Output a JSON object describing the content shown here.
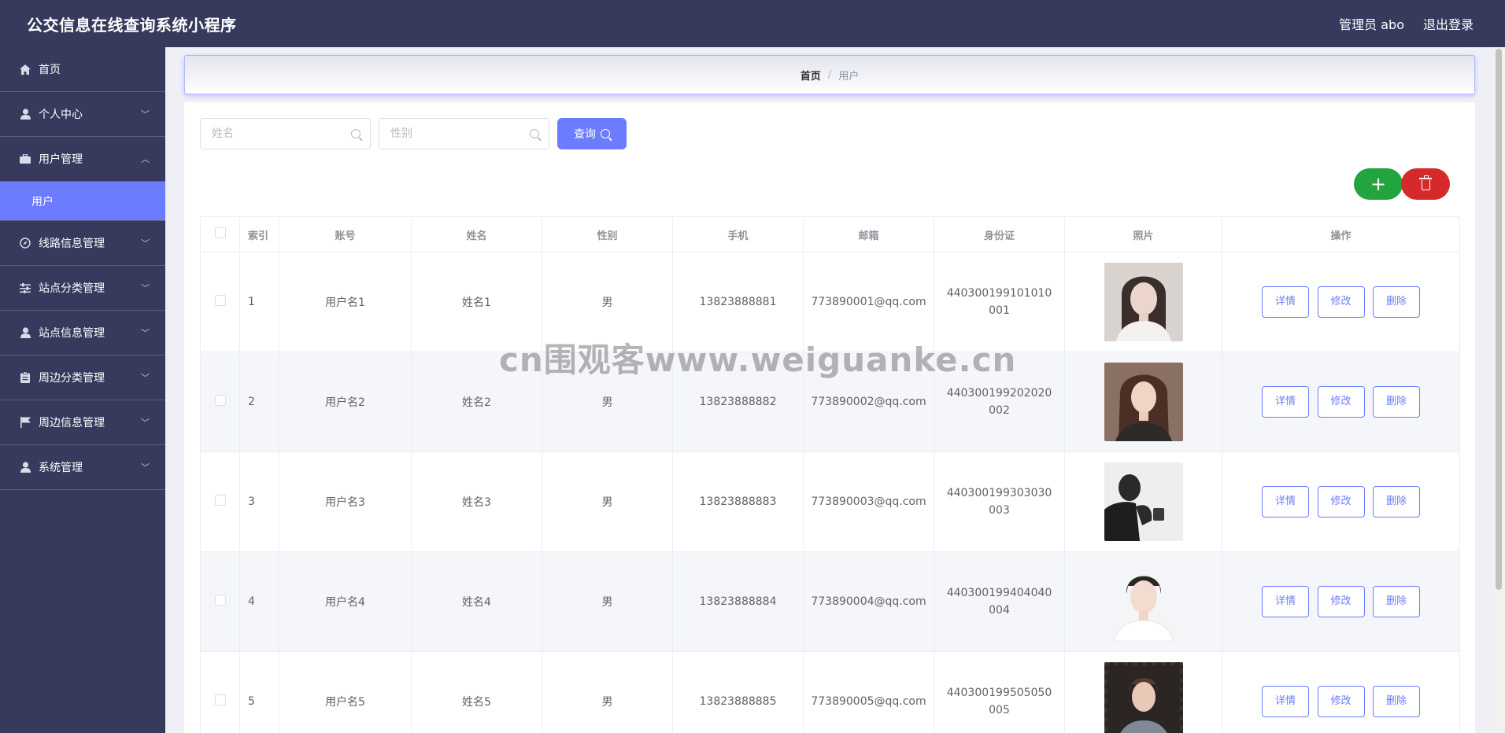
{
  "header": {
    "title": "公交信息在线查询系统小程序",
    "admin_label": "管理员 abo",
    "logout_label": "退出登录"
  },
  "sidebar": {
    "items": [
      {
        "label": "首页",
        "icon": "home-icon",
        "chevron": null
      },
      {
        "label": "个人中心",
        "icon": "user-icon",
        "chevron": "down"
      },
      {
        "label": "用户管理",
        "icon": "briefcase-icon",
        "chevron": "up"
      },
      {
        "label": "用户",
        "sub": true
      },
      {
        "label": "线路信息管理",
        "icon": "compass-icon",
        "chevron": "down"
      },
      {
        "label": "站点分类管理",
        "icon": "sliders-icon",
        "chevron": "down"
      },
      {
        "label": "站点信息管理",
        "icon": "user-icon",
        "chevron": "down"
      },
      {
        "label": "周边分类管理",
        "icon": "clipboard-icon",
        "chevron": "down"
      },
      {
        "label": "周边信息管理",
        "icon": "flag-icon",
        "chevron": "down"
      },
      {
        "label": "系统管理",
        "icon": "user-icon",
        "chevron": "down"
      }
    ]
  },
  "breadcrumb": {
    "home": "首页",
    "separator": "/",
    "current": "用户"
  },
  "search": {
    "name_placeholder": "姓名",
    "gender_placeholder": "性别",
    "query_label": "查询"
  },
  "actions": {
    "add_symbol": "+"
  },
  "table": {
    "headers": [
      "索引",
      "账号",
      "姓名",
      "性别",
      "手机",
      "邮箱",
      "身份证",
      "照片",
      "操作"
    ],
    "row_buttons": {
      "detail": "详情",
      "edit": "修改",
      "delete": "删除"
    },
    "rows": [
      {
        "index": "1",
        "account": "用户名1",
        "name": "姓名1",
        "gender": "男",
        "phone": "13823888881",
        "email": "773890001@qq.com",
        "idcard": "440300199101010001"
      },
      {
        "index": "2",
        "account": "用户名2",
        "name": "姓名2",
        "gender": "男",
        "phone": "13823888882",
        "email": "773890002@qq.com",
        "idcard": "440300199202020002"
      },
      {
        "index": "3",
        "account": "用户名3",
        "name": "姓名3",
        "gender": "男",
        "phone": "13823888883",
        "email": "773890003@qq.com",
        "idcard": "440300199303030003"
      },
      {
        "index": "4",
        "account": "用户名4",
        "name": "姓名4",
        "gender": "男",
        "phone": "13823888884",
        "email": "773890004@qq.com",
        "idcard": "440300199404040004"
      },
      {
        "index": "5",
        "account": "用户名5",
        "name": "姓名5",
        "gender": "男",
        "phone": "13823888885",
        "email": "773890005@qq.com",
        "idcard": "440300199505050005"
      }
    ]
  },
  "watermark": "cn围观客www.weiguanke.cn",
  "colors": {
    "primary": "#6b7cff",
    "sidebar_bg": "#363a5d",
    "add_green": "#22a53f",
    "delete_red": "#d5292c"
  }
}
